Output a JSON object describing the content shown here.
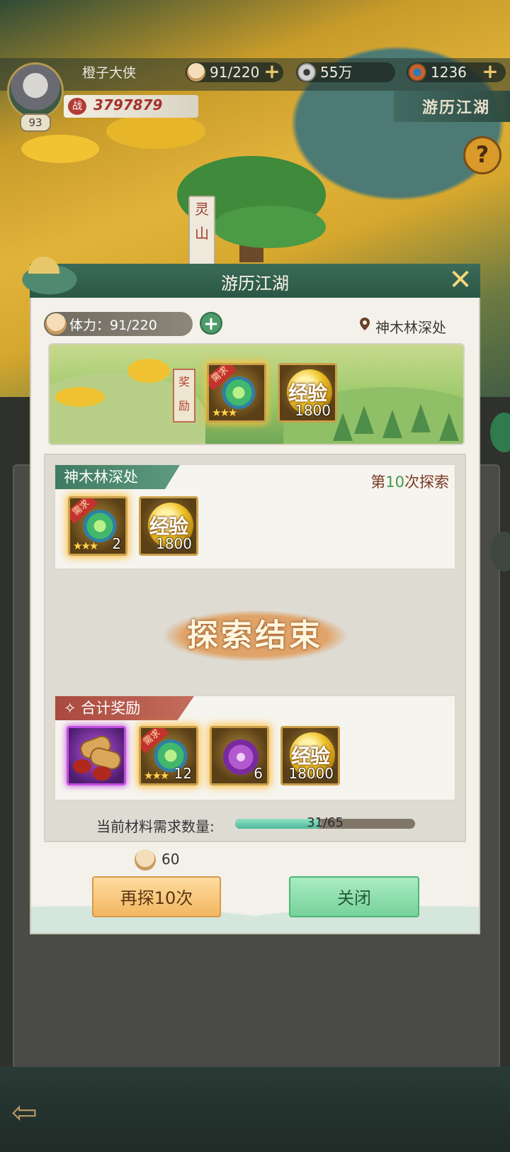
{
  "hud": {
    "player_name": "橙子大侠",
    "level": "93",
    "stamina": "91/220",
    "coins": "55万",
    "gems": "1236",
    "power_icon_char": "战",
    "power": "3797879",
    "area_title": "游历江湖",
    "help_symbol": "?",
    "plus_symbol": "+"
  },
  "background": {
    "sign_text": [
      "灵",
      "山"
    ]
  },
  "dialog": {
    "title": "游历江湖",
    "close_symbol": "✕",
    "stamina_label": "体力：91/220",
    "stamina_plus": "+",
    "location": "神木林深处",
    "scene_reward_tag": [
      "奖",
      "励"
    ],
    "scene_rewards": [
      {
        "type": "feather",
        "need": "需求",
        "stars": "★★★",
        "count": ""
      },
      {
        "type": "exp",
        "word": "经验",
        "count": "1800"
      }
    ],
    "section1": {
      "tab": "神木林深处",
      "count_prefix": "第",
      "count_num": "10",
      "count_suffix": "次探索",
      "items": [
        {
          "type": "feather",
          "need": "需求",
          "stars": "★★★",
          "count": "2"
        },
        {
          "type": "exp",
          "word": "经验",
          "count": "1800"
        }
      ]
    },
    "explore_end": "探索结束",
    "section2": {
      "tab": "✧ 合计奖励",
      "items": [
        {
          "type": "peanut",
          "count": ""
        },
        {
          "type": "feather",
          "need": "需求",
          "stars": "★★★",
          "count": "12"
        },
        {
          "type": "flower",
          "count": "6"
        },
        {
          "type": "exp",
          "word": "经验",
          "count": "18000"
        }
      ]
    },
    "material": {
      "label": "当前材料需求数量:",
      "current": 31,
      "total": 65,
      "text": "31/65"
    },
    "cost": "60",
    "retry_button": "再探10次",
    "close_button": "关闭"
  },
  "colors": {
    "accent_green": "#3f7a63",
    "gold": "#f1c332",
    "power_red": "#a5322c"
  }
}
